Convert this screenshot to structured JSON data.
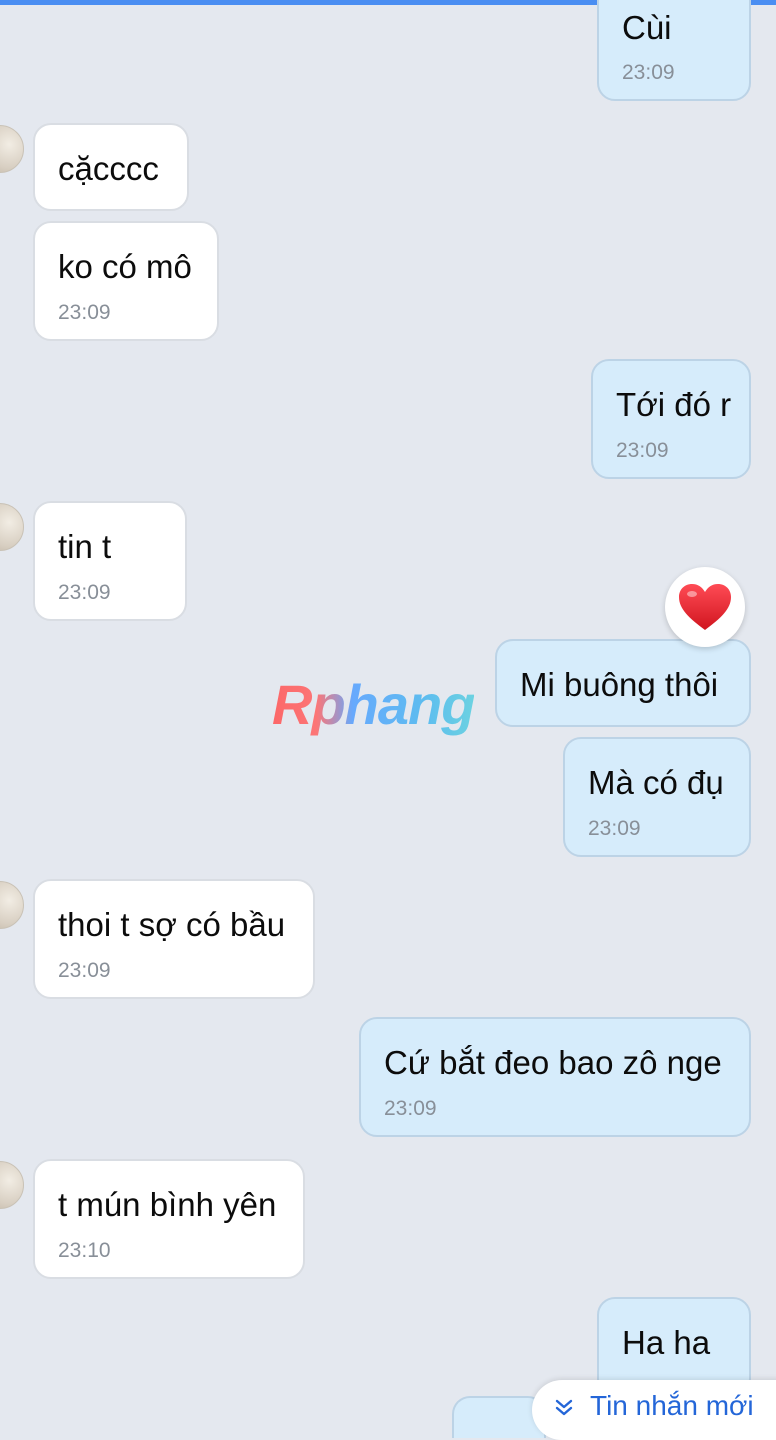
{
  "messages": [
    {
      "id": "m1",
      "dir": "out",
      "text": "Cùi",
      "time": "23:09"
    },
    {
      "id": "m2",
      "dir": "in",
      "text": "cặcccc",
      "time": ""
    },
    {
      "id": "m3",
      "dir": "in",
      "text": "ko có mô",
      "time": "23:09"
    },
    {
      "id": "m4",
      "dir": "out",
      "text": "Tới đó r",
      "time": "23:09"
    },
    {
      "id": "m5",
      "dir": "in",
      "text": "tin t",
      "time": "23:09"
    },
    {
      "id": "m6",
      "dir": "out",
      "text": "Mi buông thôi",
      "time": "",
      "reaction": "heart-icon"
    },
    {
      "id": "m7",
      "dir": "out",
      "text": "Mà có đụ",
      "time": "23:09"
    },
    {
      "id": "m8",
      "dir": "in",
      "text": "thoi t sợ có bầu",
      "time": "23:09"
    },
    {
      "id": "m9",
      "dir": "out",
      "text": "Cứ bắt đeo bao zô nge",
      "time": "23:09"
    },
    {
      "id": "m10",
      "dir": "in",
      "text": "t mún bình yên",
      "time": "23:10"
    },
    {
      "id": "m11",
      "dir": "out",
      "text": "Ha ha",
      "time": ""
    }
  ],
  "watermark": "Rphang",
  "new_messages_label": "Tin nhắn mới",
  "colors": {
    "incoming_bubble": "#ffffff",
    "outgoing_bubble": "#d6ecfb",
    "background": "#e4e8ef",
    "accent": "#2466d8"
  }
}
